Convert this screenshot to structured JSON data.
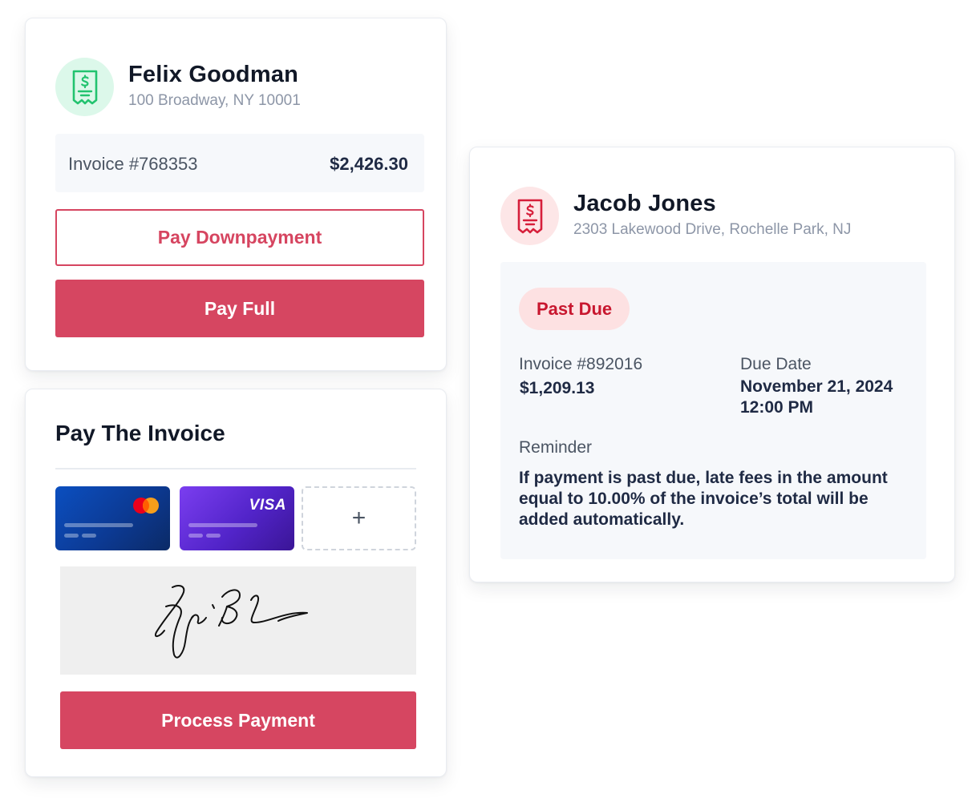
{
  "colors": {
    "brand_red": "#d64661",
    "green_icon": "#22c36f",
    "red_icon": "#d61f3b",
    "past_due_text": "#c8172f",
    "past_due_bg": "#fde1e2"
  },
  "invoice_card": {
    "icon": "receipt-icon",
    "customer_name": "Felix Goodman",
    "customer_address": "100 Broadway, NY 10001",
    "invoice_number": "Invoice #768353",
    "invoice_amount": "$2,426.30",
    "downpayment_button": "Pay Downpayment",
    "full_button": "Pay Full"
  },
  "payment_card": {
    "title": "Pay The Invoice",
    "cards": [
      {
        "brand": "mastercard",
        "icon": "mastercard-logo-icon"
      },
      {
        "brand": "visa",
        "logo_text": "VISA"
      }
    ],
    "add_card_symbol": "+",
    "signature_icon": "signature-icon",
    "process_button": "Process Payment"
  },
  "past_due_card": {
    "icon": "receipt-icon",
    "customer_name": "Jacob Jones",
    "customer_address": "2303 Lakewood Drive, Rochelle Park, NJ",
    "status_badge": "Past Due",
    "invoice_number": "Invoice #892016",
    "invoice_amount": "$1,209.13",
    "due_date_label": "Due Date",
    "due_date": "November 21, 2024",
    "due_time": "12:00 PM",
    "reminder_label": "Reminder",
    "reminder_text": "If payment is past due, late fees in the amount equal to 10.00% of the invoice’s total will be added automatically."
  }
}
